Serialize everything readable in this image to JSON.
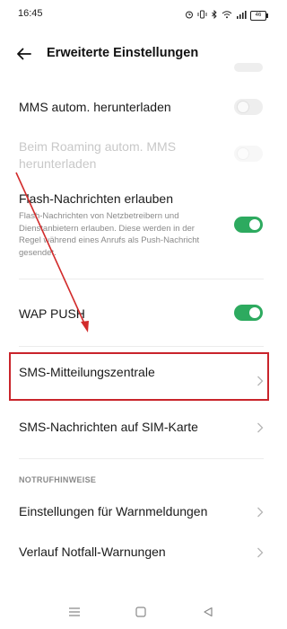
{
  "status_bar": {
    "time": "16:45",
    "icons": [
      "alarm-icon",
      "vibrate-icon",
      "bluetooth-icon",
      "wifi-icon",
      "signal-icon"
    ],
    "battery": "46"
  },
  "header": {
    "title": "Erweiterte Einstellungen"
  },
  "settings": {
    "mms_download": {
      "label": "MMS autom. herunterladen",
      "enabled": false
    },
    "roaming_mms": {
      "label": "Beim Roaming autom. MMS herunterladen",
      "enabled": false,
      "disabled": true
    },
    "flash_messages": {
      "label": "Flash-Nachrichten erlauben",
      "description": "Flash-Nachrichten von Netzbetreibern und Dienstanbietern erlauben. Diese werden in der Regel während eines Anrufs als Push-Nachricht gesendet.",
      "enabled": true
    },
    "wap_push": {
      "label": "WAP PUSH",
      "enabled": true
    },
    "sms_center": {
      "label": "SMS-Mitteilungszentrale"
    },
    "sim_messages": {
      "label": "SMS-Nachrichten auf SIM-Karte"
    }
  },
  "emergency": {
    "section_title": "NOTRUFHINWEISE",
    "warning_settings": {
      "label": "Einstellungen für Warnmeldungen"
    },
    "warning_history": {
      "label": "Verlauf Notfall-Warnungen"
    }
  },
  "colors": {
    "accent_green": "#2daa5f",
    "annotation_red": "#c9242b"
  }
}
